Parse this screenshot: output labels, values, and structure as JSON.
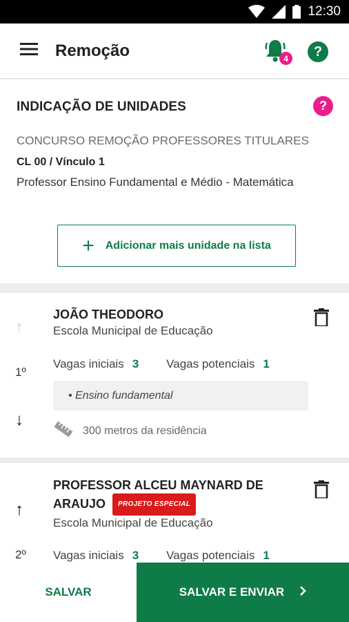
{
  "status_bar": {
    "time": "12:30",
    "icons": [
      "wifi-icon",
      "signal-icon",
      "battery-icon"
    ]
  },
  "app_bar": {
    "title": "Remoção",
    "menu_icon": "menu-icon",
    "notifications_icon": "bell-icon",
    "notification_count": "4",
    "help_icon": "help-icon",
    "help_glyph": "?"
  },
  "header": {
    "section_title": "INDICAÇÃO DE UNIDADES",
    "help_glyph": "?",
    "concurso": "CONCURSO REMOÇÃO PROFESSORES TITULARES",
    "vinculo": "CL 00 / Vínculo 1",
    "cargo": "Professor Ensino Fundamental e Médio - Matemática",
    "add_button": {
      "icon": "+",
      "label": "Adicionar mais unidade na lista"
    }
  },
  "units": [
    {
      "rank": "1º",
      "name": "JOÃO THEODORO",
      "school": "Escola Municipal de Educação",
      "vagas_iniciais_label": "Vagas iniciais",
      "vagas_iniciais": "3",
      "vagas_potenciais_label": "Vagas potenciais",
      "vagas_potenciais": "1",
      "ensino": "• Ensino fundamental",
      "distance": "300 metros da residência",
      "up_arrow": "↑",
      "down_arrow": "↓"
    },
    {
      "rank": "2º",
      "name_line1": "PROFESSOR ALCEU MAYNARD DE",
      "name_line2": "ARAUJO",
      "tag": "PROJETO ESPECIAL",
      "school": "Escola Municipal de Educação",
      "vagas_iniciais_label": "Vagas iniciais",
      "vagas_iniciais": "3",
      "vagas_potenciais_label": "Vagas potenciais",
      "vagas_potenciais": "1",
      "up_arrow": "↑"
    }
  ],
  "bottom_bar": {
    "save_label": "SALVAR",
    "save_send_label": "SALVAR E ENVIAR",
    "chevron": "›"
  },
  "colors": {
    "primary_green": "#0f7b47",
    "accent_pink": "#e91e8c",
    "tag_red": "#d81b1b"
  }
}
